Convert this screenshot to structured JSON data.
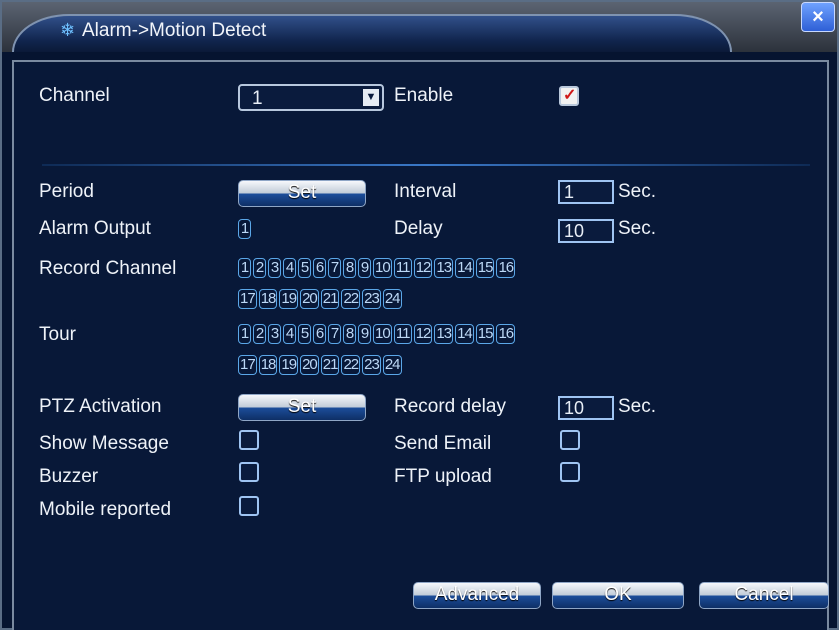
{
  "window": {
    "title": "Alarm->Motion Detect",
    "title_icon": "alarm-icon",
    "close_icon": "close-icon",
    "close_glyph": "×"
  },
  "form": {
    "channel_label": "Channel",
    "channel_value": "1",
    "enable_label": "Enable",
    "enable_checked": true,
    "period_label": "Period",
    "period_button": "Set",
    "interval_label": "Interval",
    "interval_value": "1",
    "interval_unit": "Sec.",
    "alarm_output_label": "Alarm Output",
    "alarm_output_channels": [
      "1"
    ],
    "delay_label": "Delay",
    "delay_value": "10",
    "delay_unit": "Sec.",
    "record_channel_label": "Record Channel",
    "record_channels": [
      "1",
      "2",
      "3",
      "4",
      "5",
      "6",
      "7",
      "8",
      "9",
      "10",
      "11",
      "12",
      "13",
      "14",
      "15",
      "16",
      "17",
      "18",
      "19",
      "20",
      "21",
      "22",
      "23",
      "24"
    ],
    "tour_label": "Tour",
    "tour_channels": [
      "1",
      "2",
      "3",
      "4",
      "5",
      "6",
      "7",
      "8",
      "9",
      "10",
      "11",
      "12",
      "13",
      "14",
      "15",
      "16",
      "17",
      "18",
      "19",
      "20",
      "21",
      "22",
      "23",
      "24"
    ],
    "ptz_label": "PTZ Activation",
    "ptz_button": "Set",
    "record_delay_label": "Record delay",
    "record_delay_value": "10",
    "record_delay_unit": "Sec.",
    "show_message_label": "Show Message",
    "send_email_label": "Send Email",
    "buzzer_label": "Buzzer",
    "ftp_upload_label": "FTP upload",
    "mobile_reported_label": "Mobile reported"
  },
  "buttons": {
    "advanced": "Advanced",
    "ok": "OK",
    "cancel": "Cancel"
  },
  "colors": {
    "background": "#061430",
    "accent": "#5ba7e8",
    "check": "#d01818"
  }
}
